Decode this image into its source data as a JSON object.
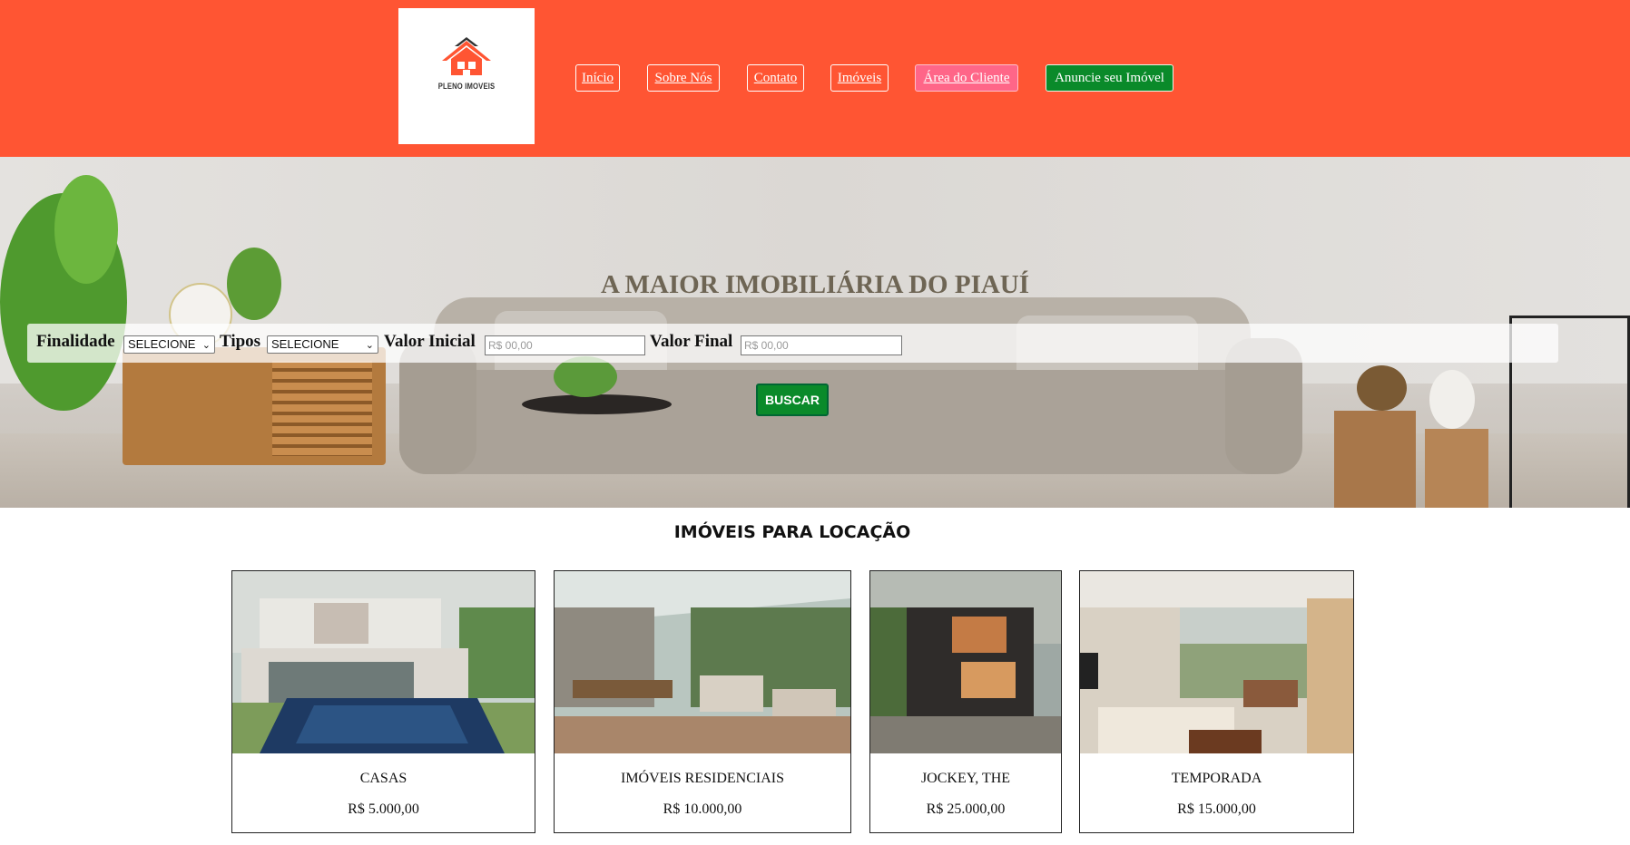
{
  "brand": {
    "logo_text": "PLENO IMOVEIS"
  },
  "nav": {
    "items": [
      "Início",
      "Sobre Nós",
      "Contato",
      "Imóveis",
      "Área do Cliente",
      "Anuncie seu Imóvel"
    ]
  },
  "hero": {
    "title": "A MAIOR IMOBILIÁRIA DO PIAUÍ",
    "search": {
      "finalidade_label": "Finalidade",
      "finalidade_value": "SELECIONE",
      "tipos_label": "Tipos",
      "tipos_value": "SELECIONE",
      "valor_inicial_label": "Valor Inicial",
      "valor_inicial_placeholder": "R$ 00,00",
      "valor_final_label": "Valor Final",
      "valor_final_placeholder": "R$ 00,00",
      "button": "BUSCAR"
    }
  },
  "listings": {
    "title": "IMÓVEIS PARA LOCAÇÃO",
    "items": [
      {
        "name": "CASAS",
        "price": "R$ 5.000,00"
      },
      {
        "name": "IMÓVEIS RESIDENCIAIS",
        "price": "R$ 10.000,00"
      },
      {
        "name": "JOCKEY, THE",
        "price": "R$ 25.000,00"
      },
      {
        "name": "TEMPORADA",
        "price": "R$ 15.000,00"
      }
    ]
  },
  "colors": {
    "header_bg": "#ff5533",
    "client_button": "#ff6688",
    "announce_button": "#0a8a2a",
    "search_button": "#0a8a2a"
  }
}
